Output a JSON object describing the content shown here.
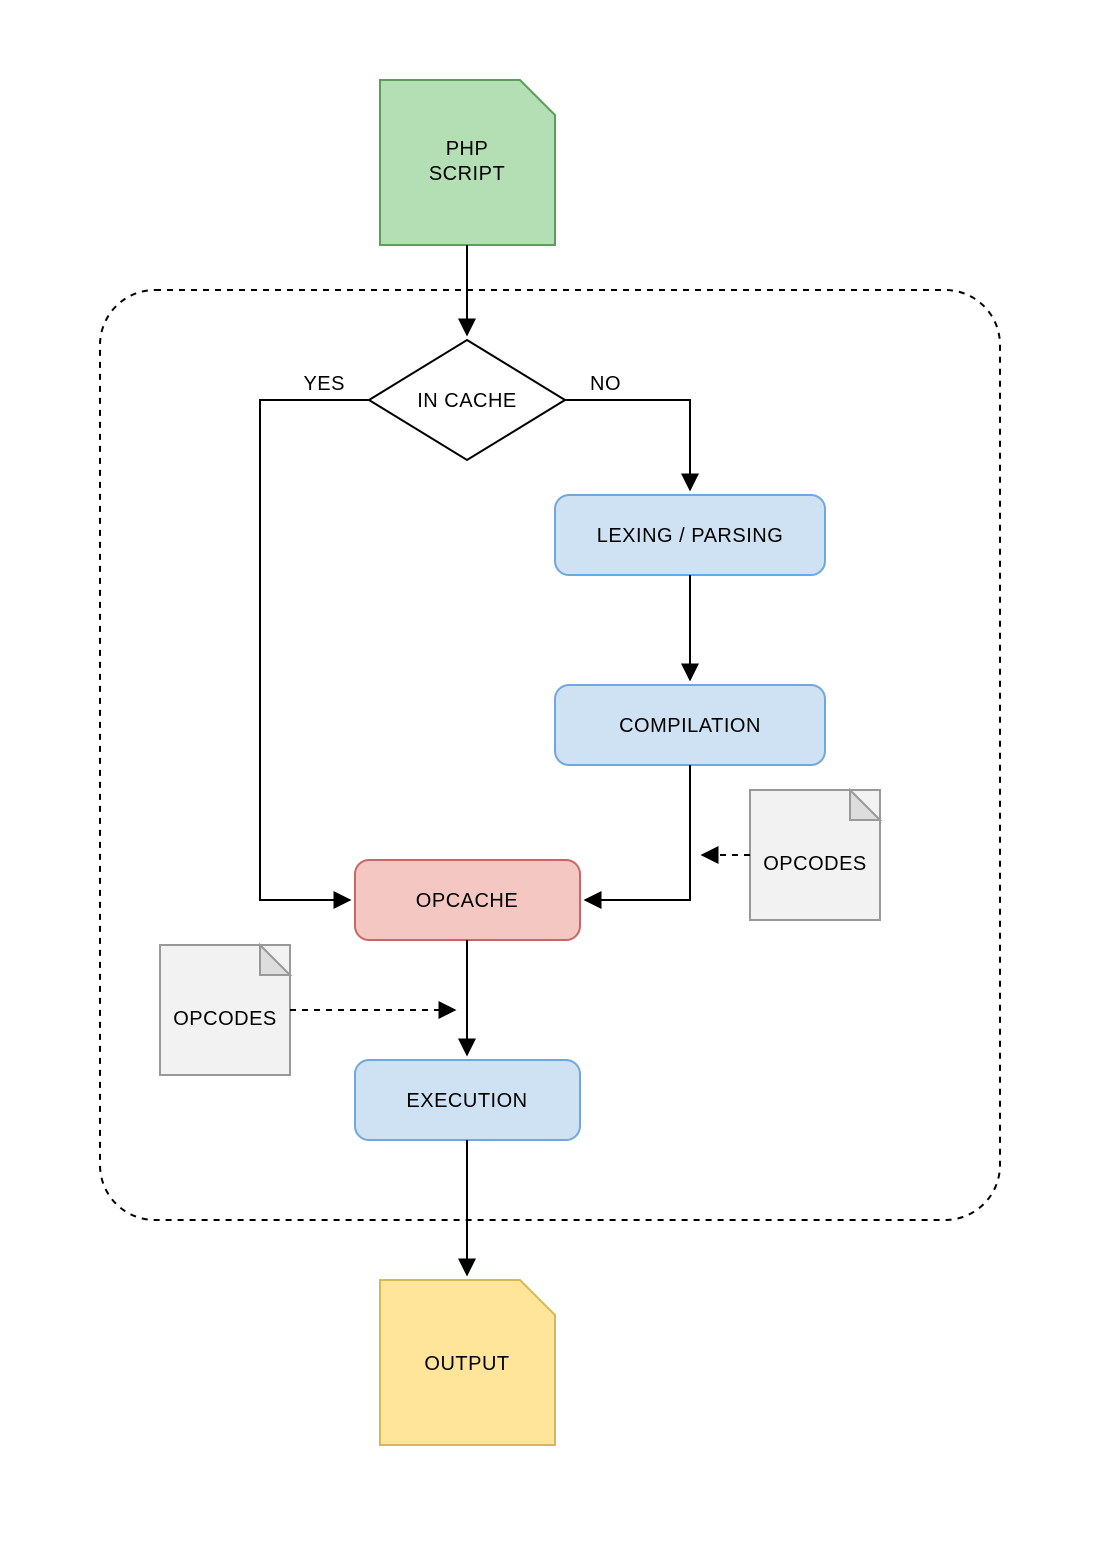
{
  "nodes": {
    "phpScript": {
      "line1": "PHP",
      "line2": "SCRIPT"
    },
    "inCache": "IN CACHE",
    "yes": "YES",
    "no": "NO",
    "lexing": "LEXING / PARSING",
    "compilation": "COMPILATION",
    "opcache": "OPCACHE",
    "opcodesRight": "OPCODES",
    "opcodesLeft": "OPCODES",
    "execution": "EXECUTION",
    "output": "OUTPUT"
  },
  "colors": {
    "green": "#b4deb4",
    "greenStroke": "#5a9e5a",
    "blue": "#cfe2f3",
    "blueStroke": "#6fa8dc",
    "red": "#f4c7c3",
    "redStroke": "#cc6666",
    "yellow": "#ffe599",
    "yellowStroke": "#d4b955",
    "grey": "#f2f2f2",
    "greyStroke": "#999999",
    "black": "#000000"
  }
}
